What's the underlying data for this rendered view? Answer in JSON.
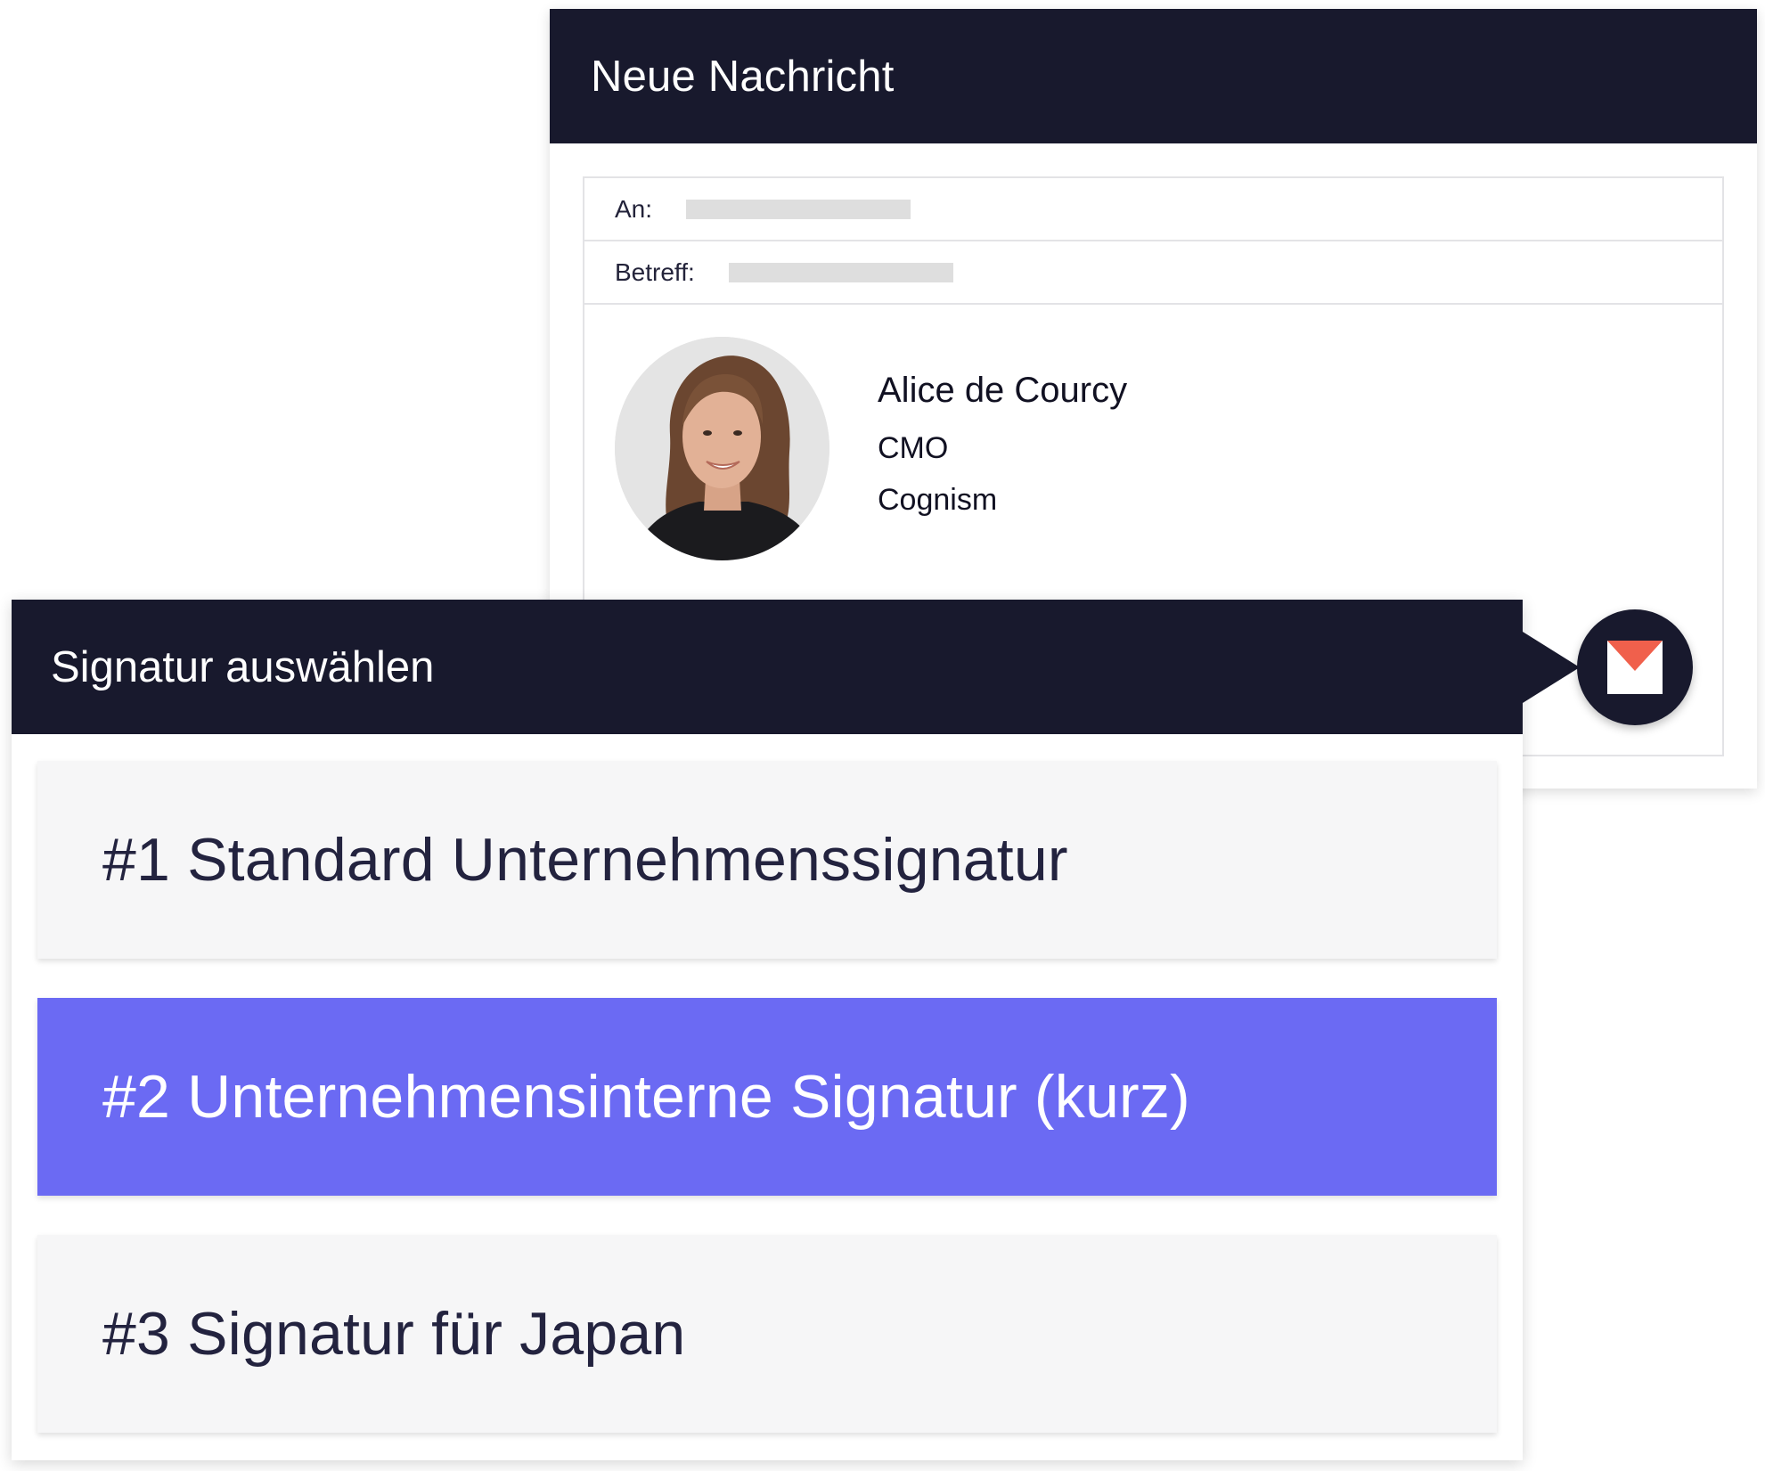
{
  "compose": {
    "title": "Neue Nachricht",
    "to_label": "An:",
    "subject_label": "Betreff:",
    "signature": {
      "name": "Alice de Courcy",
      "role": "CMO",
      "company": "Cognism"
    }
  },
  "picker": {
    "title": "Signatur auswählen",
    "options": [
      {
        "label": "#1 Standard Unternehmenssignatur"
      },
      {
        "label": "#2 Unternehmensinterne Signatur (kurz)"
      },
      {
        "label": "#3 Signatur für Japan"
      }
    ],
    "selected_index": 1
  },
  "icons": {
    "mail_badge": "envelope-icon",
    "avatar": "profile-photo"
  },
  "colors": {
    "header_bg": "#18192d",
    "selected_bg": "#6b6af3",
    "option_bg": "#f6f6f7",
    "envelope_flap": "#f0604c"
  }
}
